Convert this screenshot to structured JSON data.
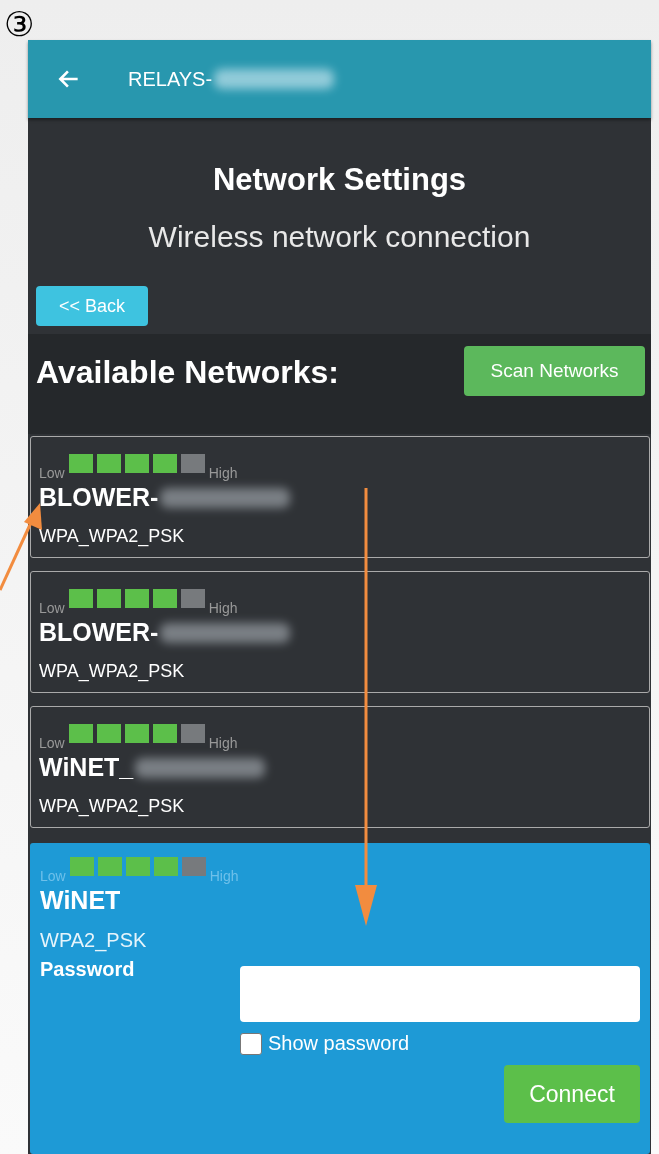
{
  "step_marker": "③",
  "app_bar": {
    "title": "RELAYS-"
  },
  "header": {
    "title": "Network Settings",
    "subtitle": "Wireless network connection"
  },
  "back_button": "<< Back",
  "networks_heading": "Available Networks:",
  "scan_button": "Scan Networks",
  "networks": [
    {
      "low_label": "Low",
      "high_label": "High",
      "stars": 4,
      "ssid": "BLOWER-",
      "redacted": true,
      "security": "WPA_WPA2_PSK",
      "selected": false
    },
    {
      "low_label": "Low",
      "high_label": "High",
      "stars": 4,
      "ssid": "BLOWER-",
      "redacted": true,
      "security": "WPA_WPA2_PSK",
      "selected": false
    },
    {
      "low_label": "Low",
      "high_label": "High",
      "stars": 4,
      "ssid": "WiNET_",
      "redacted": true,
      "security": "WPA_WPA2_PSK",
      "selected": false
    },
    {
      "low_label": "Low",
      "high_label": "High",
      "stars": 4,
      "ssid": "WiNET",
      "redacted": false,
      "security": "WPA2_PSK",
      "selected": true
    }
  ],
  "connect_form": {
    "password_label": "Password",
    "show_password": {
      "label": "Show password",
      "checked": false
    },
    "connect_button": "Connect"
  }
}
